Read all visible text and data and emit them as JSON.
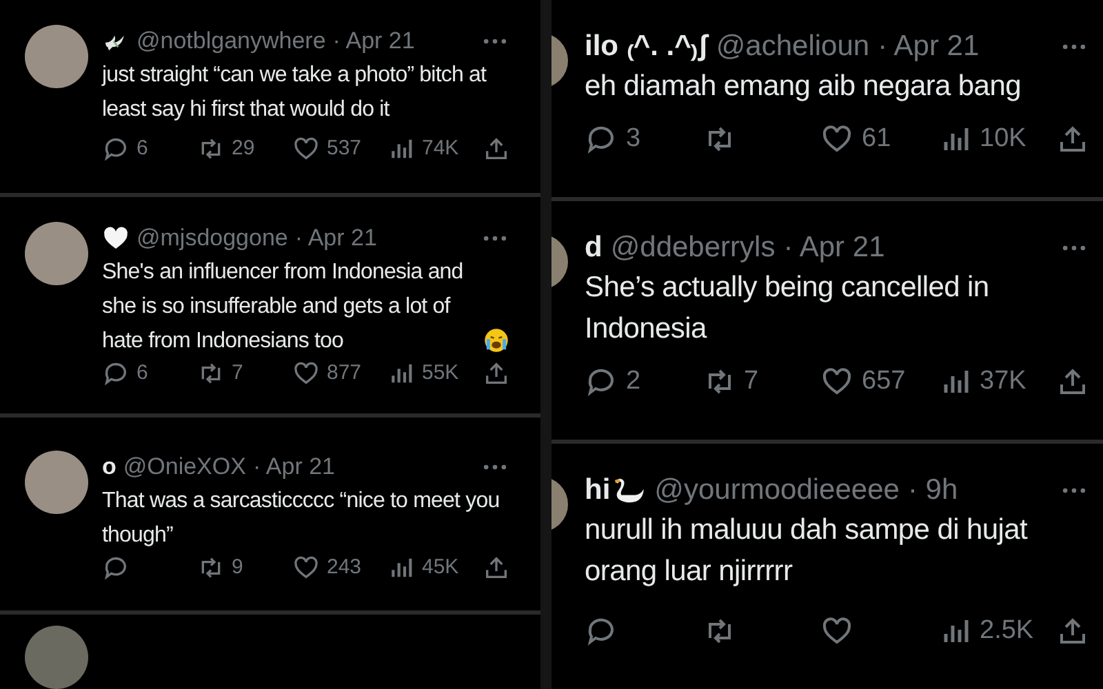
{
  "columns": [
    {
      "tweets": [
        {
          "name_icon": {
            "kind": "dove"
          },
          "handle": "@notblganywhere",
          "time": "· Apr 21",
          "text": "just straight “can we take a photo” bitch at least say hi first that would do it",
          "stats": {
            "replies": "6",
            "reposts": "29",
            "likes": "537",
            "views": "74K"
          }
        },
        {
          "name_icon": {
            "kind": "heart"
          },
          "handle": "@mjsdoggone",
          "time": "· Apr 21",
          "text": "She's an influencer from Indonesia and she is so insufferable and gets a lot of hate from Indonesians too",
          "end_emoji": {
            "kind": "crying"
          },
          "stats": {
            "replies": "6",
            "reposts": "7",
            "likes": "877",
            "views": "55K"
          }
        },
        {
          "name": "o",
          "handle": "@OnieXOX",
          "time": "· Apr 21",
          "text": "That was a sarcasticcccc “nice to meet you though”",
          "stats": {
            "reposts": "9",
            "likes": "243",
            "views": "45K"
          }
        }
      ]
    },
    {
      "tweets": [
        {
          "name": "ilo ₍^. .^₎ʃ",
          "handle": "@achelioun",
          "time": "· Apr 21",
          "text": "eh diamah emang aib negara bang",
          "stats": {
            "replies": "3",
            "likes": "61",
            "views": "10K"
          }
        },
        {
          "name": "d",
          "handle": "@ddeberryls",
          "time": "· Apr 21",
          "text": "She’s actually being cancelled in Indonesia",
          "stats": {
            "replies": "2",
            "reposts": "7",
            "likes": "657",
            "views": "37K"
          }
        },
        {
          "name": "hi",
          "name_icon": {
            "kind": "swan"
          },
          "handle": "@yourmoodieeeee",
          "time": "· 9h",
          "text": "nurull ih maluuu dah sampe di hujat orang luar njirrrrr",
          "stats": {
            "views": "2.5K"
          }
        }
      ]
    }
  ]
}
